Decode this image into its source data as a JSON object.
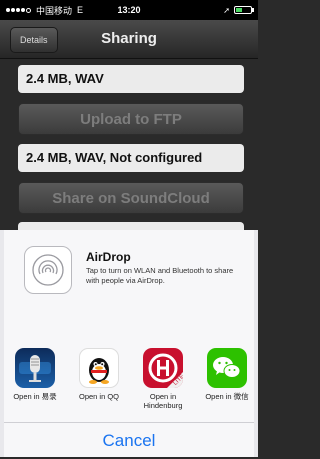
{
  "status_bar": {
    "carrier": "中国移动",
    "network": "E",
    "time": "13:20"
  },
  "nav": {
    "back_label": "Details",
    "title": "Sharing"
  },
  "content": {
    "row1": "2.4 MB, WAV",
    "upload_ftp": "Upload to FTP",
    "row2": "2.4 MB, WAV, Not configured",
    "share_soundcloud": "Share on SoundCloud"
  },
  "share_sheet": {
    "airdrop": {
      "title": "AirDrop",
      "description": "Tap to turn on WLAN and Bluetooth to share with people via AirDrop."
    },
    "apps": [
      {
        "label": "Open in 易录",
        "icon": "microphone-icon"
      },
      {
        "label": "Open in QQ",
        "icon": "qq-penguin-icon"
      },
      {
        "label": "Open in Hindenburg",
        "icon": "hindenburg-lite-icon"
      },
      {
        "label": "Open in 微信",
        "icon": "wechat-icon"
      }
    ],
    "cancel_label": "Cancel"
  },
  "colors": {
    "accent": "#1a74f0",
    "nav_bg": "#333333",
    "sheet_bg": "#f7f7f9"
  }
}
